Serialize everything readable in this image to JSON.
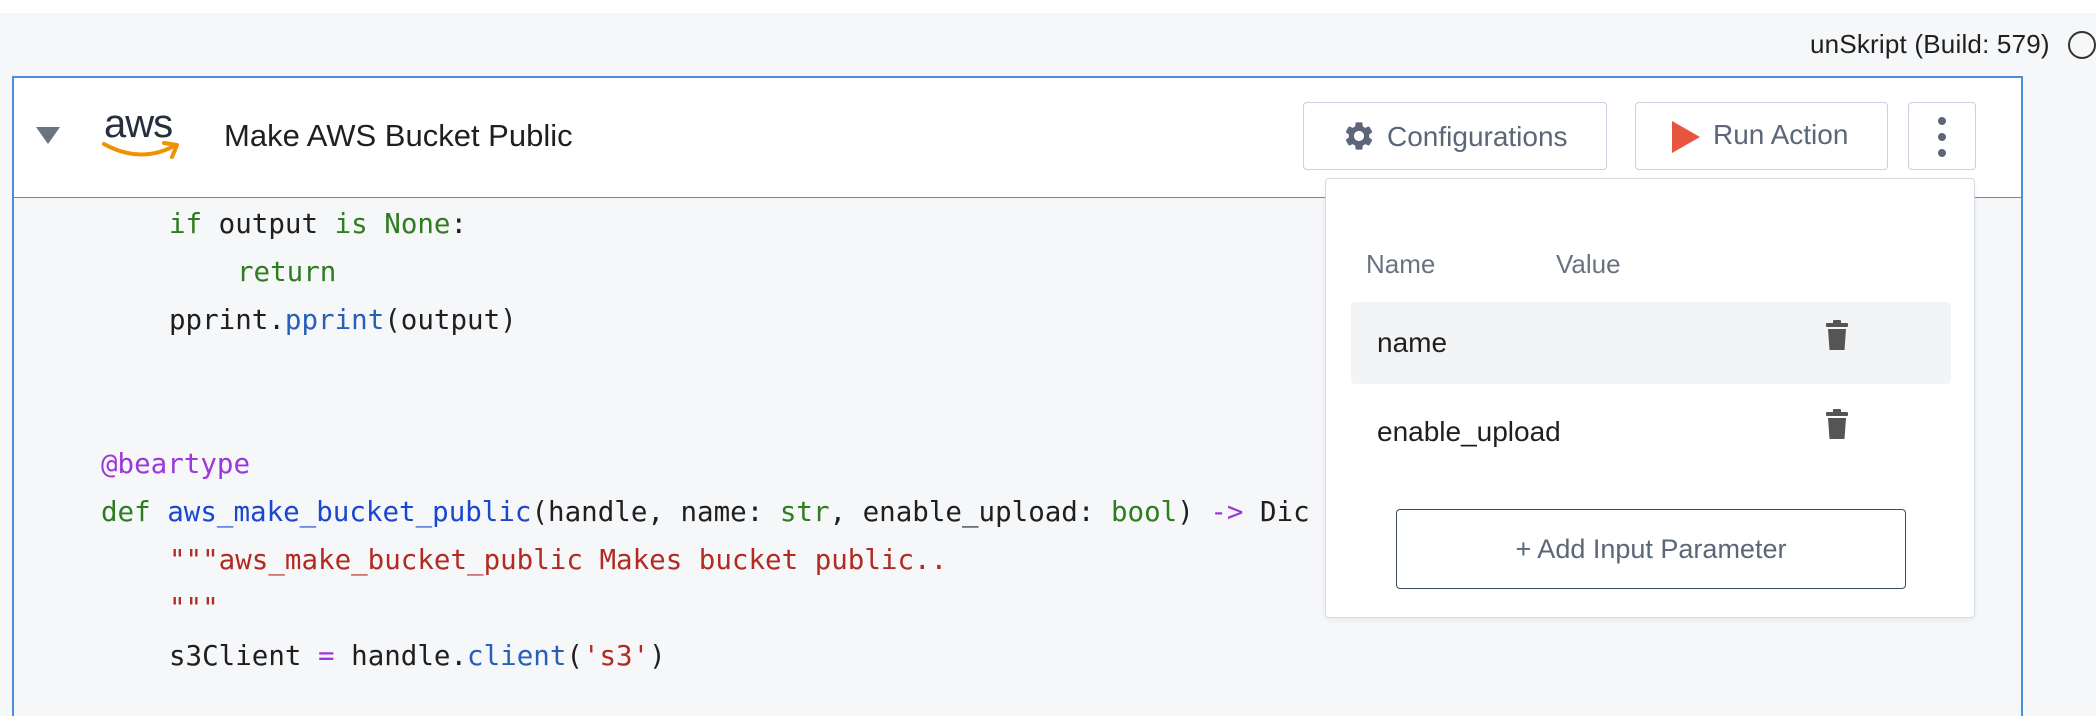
{
  "build_label": "unSkript (Build: 579)",
  "cell": {
    "title": "Make AWS Bucket Public",
    "logo_text": "aws",
    "buttons": {
      "configurations": "Configurations",
      "run_action": "Run Action"
    }
  },
  "code_lines": {
    "l1_kw": "if",
    "l1_mid": " output ",
    "l1_kw2": "is",
    "l1_kw3": " None",
    "l1_end": ":",
    "l2_kw": "return",
    "l3_obj": "pprint.",
    "l3_fn": "pprint",
    "l3_end": "(output)",
    "l4_dec": "@beartype",
    "l5_kw": "def ",
    "l5_fn": "aws_make_bucket_public",
    "l5_a": "(handle, name: ",
    "l5_t1": "str",
    "l5_b": ", enable_upload: ",
    "l5_t2": "bool",
    "l5_c": ") ",
    "l5_arrow": "->",
    "l5_d": " Dic",
    "l6_str": "\"\"\"aws_make_bucket_public Makes bucket public..",
    "l7_str": "\"\"\"",
    "l8_a": "s3Client ",
    "l8_op": "=",
    "l8_b": " handle.",
    "l8_fn": "client",
    "l8_c": "(",
    "l8_str": "'s3'",
    "l8_d": ")"
  },
  "config_popover": {
    "col_name": "Name",
    "col_value": "Value",
    "params": [
      {
        "name": "name"
      },
      {
        "name": "enable_upload"
      }
    ],
    "add_button": "+ Add Input Parameter"
  },
  "icons": {
    "collapse": "triangle-down-icon",
    "logo": "aws-logo",
    "gear": "gear-icon",
    "play": "play-icon",
    "more": "kebab-menu-icon",
    "trash": "trash-icon",
    "status": "status-circle-icon"
  },
  "colors": {
    "accent_border": "#4a90d9",
    "run_icon": "#e8553e",
    "keyword": "#2e7d1f",
    "function": "#1a47d1",
    "decorator": "#9c37d9",
    "string": "#b22b22"
  }
}
